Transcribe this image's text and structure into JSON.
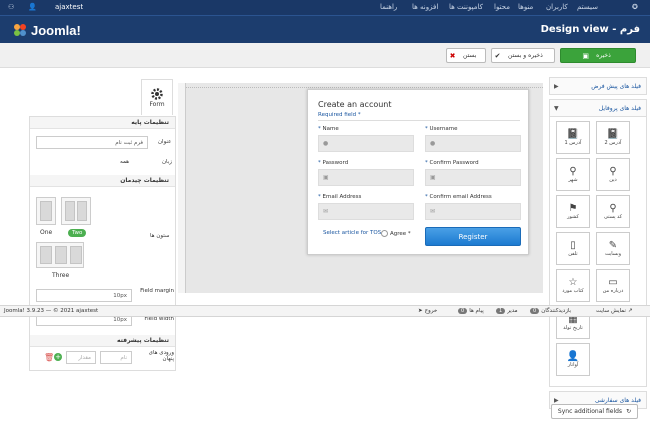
{
  "topbar": {
    "user": "ajaxtest",
    "menu": [
      "سیستم",
      "کاربران",
      "منوها",
      "محتوا",
      "کامپوننت ها",
      "افزونه ها",
      "راهنما"
    ]
  },
  "header": {
    "logo_text": "Joomla!",
    "page_title": "Design view - فرم"
  },
  "toolbar": {
    "save_label": "ذخیره",
    "save_close_label": "ذخیره و بستن",
    "close_label": "بستن"
  },
  "right_panel": {
    "default_fields": "فیلد های پیش فرض",
    "profile_fields": "فیلد های پروفایل",
    "custom_fields": "فیلد های سفارشی",
    "items": [
      "آدرس 2",
      "آدرس 1",
      "دین",
      "شهر",
      "کد پستی",
      "کشور",
      "وبسایت",
      "تلفن",
      "درباره من",
      "کتاب مورد",
      "تاریخ تولد",
      "آواتار"
    ],
    "sync_label": "Sync additional fields"
  },
  "form": {
    "title": "Create an account",
    "required": "Required field *",
    "name_label": "Name",
    "username_label": "Username",
    "password_label": "Password",
    "confirm_password_label": "Confirm Password",
    "email_label": "Email Address",
    "confirm_email_label": "Confirm email Address",
    "tos_label": "Select article for TOS",
    "agree_label": "Agree *",
    "register_label": "Register"
  },
  "left_panel": {
    "tab_label": "Form",
    "basic_settings": "تنظیمات پایه",
    "title_label": "عنوان",
    "title_value": "فرم ثبت نام",
    "language_label": "زبان",
    "language_value": "همه",
    "layout_settings": "تنظیمات چیدمان",
    "columns_label": "ستون ها",
    "col_one": "One",
    "col_two": "Two",
    "col_three": "Three",
    "field_margin_label": "Field margin",
    "field_margin_value": "10px",
    "field_width_label": "Field width",
    "field_width_value": "10px",
    "advanced_settings": "تنظیمات پیشرفته",
    "hidden_label": "ورودی های پنهان",
    "name_placeholder": "نام",
    "value_placeholder": "مقدار"
  },
  "footer": {
    "copyright": "Joomla! 3.9.23 — © 2021 ajaxtest",
    "view_site": "نمایش سایت",
    "visitors": "بازدیدکنندگان",
    "visitors_count": "0",
    "admin": "مدیر",
    "admin_count": "1",
    "messages": "پیام ها",
    "messages_count": "0",
    "logout": "خروج"
  },
  "colors": {
    "topbar": "#1a3867",
    "header": "#1c3d6e",
    "save_green": "#3ba33b",
    "register_blue": "#1c7ad0"
  }
}
